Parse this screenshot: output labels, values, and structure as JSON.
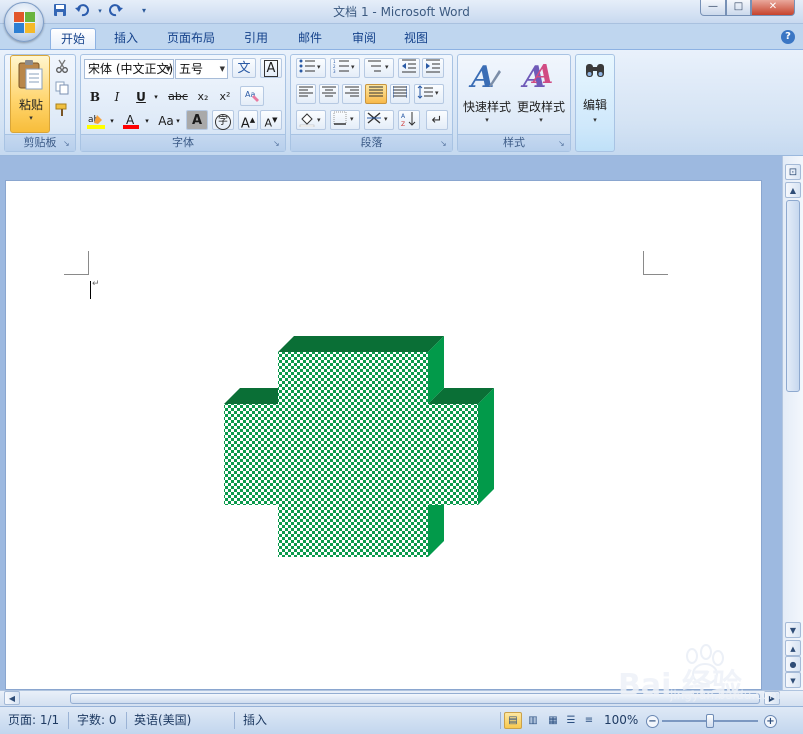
{
  "window": {
    "title": "文档 1 - Microsoft Word",
    "min_icon": "—",
    "max_icon": "□",
    "close_icon": "✕"
  },
  "quick_access": {
    "save_icon": "save-icon",
    "undo_icon": "undo-icon",
    "redo_icon": "redo-icon",
    "customize_icon": "dropdown-icon"
  },
  "tabs": [
    {
      "label": "开始",
      "active": true
    },
    {
      "label": "插入"
    },
    {
      "label": "页面布局"
    },
    {
      "label": "引用"
    },
    {
      "label": "邮件"
    },
    {
      "label": "审阅"
    },
    {
      "label": "视图"
    }
  ],
  "ribbon": {
    "clipboard": {
      "label": "剪贴板",
      "paste_label": "粘贴"
    },
    "font": {
      "label": "字体",
      "font_name": "宋体 (中文正文)",
      "font_size": "五号",
      "bold": "B",
      "italic": "I",
      "underline": "U",
      "strikethrough": "abc",
      "subscript": "x₂",
      "superscript": "x²",
      "change_case": "Aa",
      "grow_font": "A",
      "shrink_font": "A",
      "highlight_color": "#ffff00",
      "font_color": "#ff0000"
    },
    "paragraph": {
      "label": "段落"
    },
    "styles": {
      "label": "样式",
      "quick_styles": "快速样式",
      "change_styles": "更改样式"
    },
    "editing": {
      "label": "编辑"
    }
  },
  "document": {
    "shape_colors": {
      "face": "#0b9a4c",
      "pattern": "#ffffff",
      "side": "#029a4a",
      "top": "#0a6f36"
    }
  },
  "statusbar": {
    "page": "页面: 1/1",
    "words": "字数: 0",
    "language": "英语(美国)",
    "mode": "插入",
    "zoom": "100%"
  },
  "watermark": {
    "brand": "Bai  经验",
    "url": "jingyan.baidu.com"
  }
}
